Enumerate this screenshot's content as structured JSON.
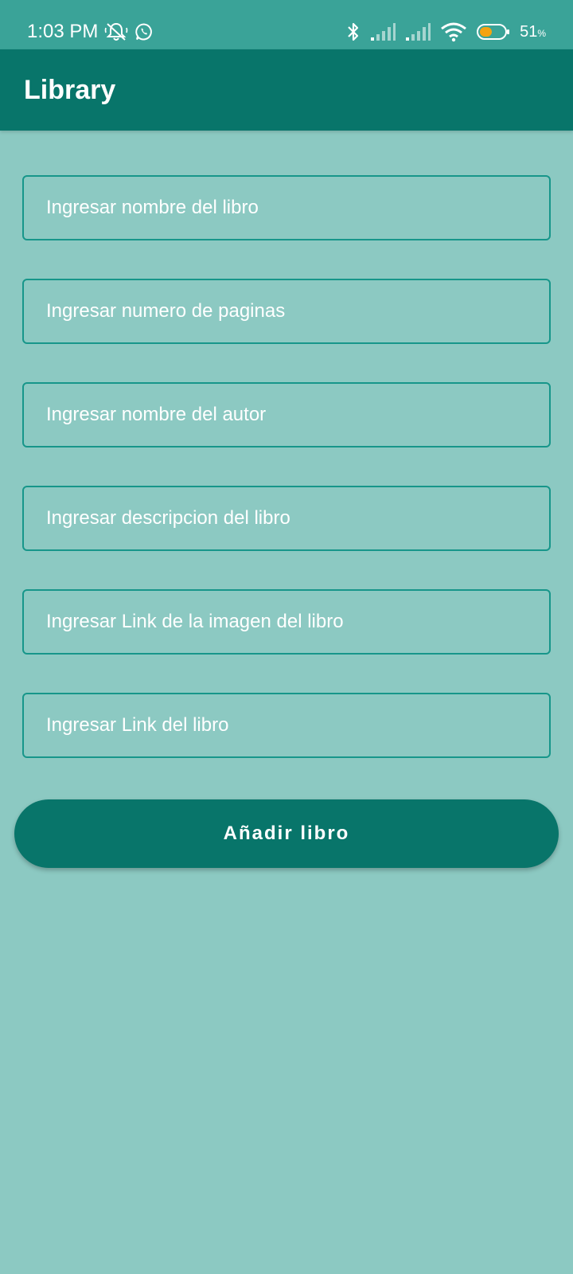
{
  "status_bar": {
    "time": "1:03 PM",
    "battery_percent": "51",
    "battery_unit": "%",
    "battery_level": 0.51,
    "colors": {
      "background": "#3aa398",
      "battery_fill": "#f3a312"
    },
    "icons": [
      "mute-alarm-icon",
      "whatsapp-icon",
      "bluetooth-icon",
      "signal-icon",
      "signal-icon",
      "wifi-icon",
      "battery-icon"
    ]
  },
  "app_bar": {
    "title": "Library",
    "color": "#08756a"
  },
  "form": {
    "fields": [
      {
        "placeholder": "Ingresar nombre del libro",
        "value": ""
      },
      {
        "placeholder": "Ingresar numero de paginas",
        "value": ""
      },
      {
        "placeholder": "Ingresar nombre del autor",
        "value": ""
      },
      {
        "placeholder": "Ingresar descripcion del libro",
        "value": ""
      },
      {
        "placeholder": "Ingresar Link de la imagen del libro",
        "value": ""
      },
      {
        "placeholder": "Ingresar Link del libro",
        "value": ""
      }
    ],
    "submit_label": "Añadir libro"
  },
  "colors": {
    "page_background": "#8cc9c2",
    "field_border": "#17968a",
    "button": "#08756a"
  }
}
